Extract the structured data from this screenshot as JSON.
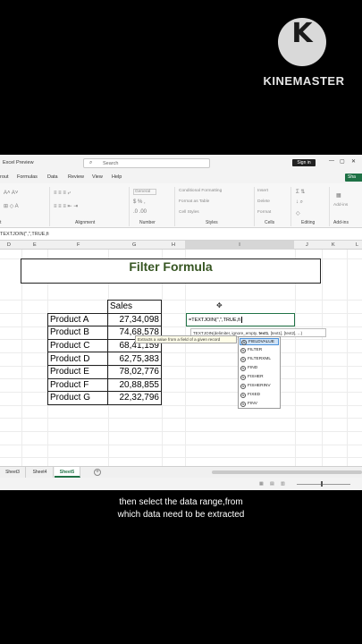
{
  "watermark": {
    "logo_letter": "K",
    "brand": "KINEMASTER"
  },
  "window": {
    "title": "Excel Preview",
    "search_placeholder": "Search",
    "signin_label": "Sign in",
    "controls": [
      "—",
      "▢",
      "✕"
    ]
  },
  "menu": {
    "items": [
      "rout",
      "Formulas",
      "Data",
      "Review",
      "View",
      "Help"
    ],
    "share_label": "Sha"
  },
  "ribbon": {
    "groups": [
      "Alignment",
      "Number",
      "Styles",
      "Cells",
      "Editing",
      "Add-ins"
    ],
    "font_label": "t",
    "number_format": "General",
    "styles_items": [
      "Conditional Formatting",
      "Format as Table",
      "Cell Styles"
    ],
    "cells_items": [
      "Insert",
      "Delete",
      "Format"
    ],
    "addins_label": "Add-ins"
  },
  "formula_bar": {
    "content": "TEXTJOIN(\",\",TRUE,fi"
  },
  "columns": [
    "D",
    "E",
    "F",
    "G",
    "H",
    "I",
    "J",
    "K",
    "L"
  ],
  "active_column": "I",
  "sheet": {
    "title": "Filter Formula",
    "header": "Sales",
    "rows": [
      {
        "product": "Product A",
        "sales": "27,34,098"
      },
      {
        "product": "Product B",
        "sales": "74,68,578"
      },
      {
        "product": "Product C",
        "sales": "68,41,159"
      },
      {
        "product": "Product D",
        "sales": "62,75,383"
      },
      {
        "product": "Product E",
        "sales": "78,02,776"
      },
      {
        "product": "Product F",
        "sales": "20,88,855"
      },
      {
        "product": "Product G",
        "sales": "22,32,796"
      }
    ]
  },
  "editing_cell": {
    "content": "=TEXTJOIN(\",\",TRUE,fi"
  },
  "signature_tip": {
    "prefix": "TEXTJOIN(delimiter, ignore_empty, ",
    "bold_arg": "text1",
    "suffix": ", [text1], [text2], ...)"
  },
  "function_tip": "Extracts a value from a field of a given record",
  "autocomplete": {
    "items": [
      "FIELDVALUE",
      "FILTER",
      "FILTERXML",
      "FIND",
      "FISHER",
      "FISHERINV",
      "FIXED",
      "FINV"
    ],
    "selected_index": 0,
    "fx_glyph": "fx"
  },
  "sheet_tabs": {
    "tabs": [
      "Sheet3",
      "Sheet4",
      "Sheet5"
    ],
    "active": "Sheet5",
    "add_glyph": "+"
  },
  "caption": {
    "line1": "then select the data range,from",
    "line2": "which data need to be extracted"
  }
}
